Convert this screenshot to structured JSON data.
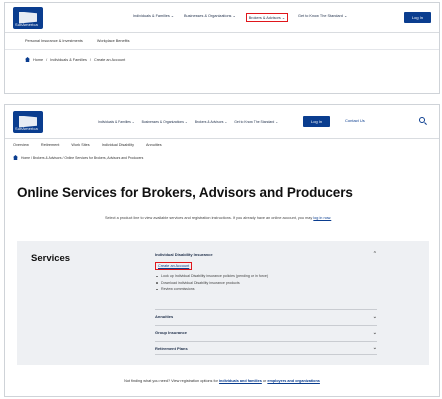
{
  "top": {
    "logo_text": "SunAmerica",
    "menu": [
      "Individuals & Families ⌄",
      "Businesses & Organizations ⌄",
      "Brokers & Advisors ⌄",
      "Get to Know The Standard ⌄"
    ],
    "login": "Log In",
    "subtabs": [
      "Personal Insurance & Investments",
      "Workplace Benefits"
    ],
    "breadcrumb": [
      "Home",
      "Individuals & Families",
      "Create an Account"
    ]
  },
  "bottom": {
    "logo_text": "SunAmerica",
    "menu": [
      "Individuals & Families ⌄",
      "Businesses & Organizations ⌄",
      "Brokers & Advisors ⌄",
      "Get to Know The Standard ⌄"
    ],
    "login": "Log In",
    "contact": "Contact Us",
    "tabs": [
      "Overview",
      "Retirement",
      "Work Sites",
      "Individual Disability",
      "Annuities"
    ],
    "breadcrumb": "Home  /  Brokers & Advisors  /  Online Services for Brokers, Advisors and Producers",
    "title": "Online Services for Brokers, Advisors and Producers",
    "intro_text": "Select a product line to view available services and registration instructions. If you already have an online account, you may",
    "intro_link": "log in now.",
    "services_heading": "Services",
    "accordion": {
      "open_title": "Individual Disability Insurance",
      "create_link": "Create an Account",
      "bullets": [
        "Look up Individual Disability insurance policies (pending or in force)",
        "Download individual Disability insurance products",
        "Review commissions"
      ],
      "rows": [
        "Annuities",
        "Group Insurance",
        "Retirement Plans"
      ]
    },
    "footer_text": "Not finding what you need? View registration options for",
    "footer_link1": "individuals and families",
    "footer_or": "or",
    "footer_link2": "employers and organizations"
  }
}
